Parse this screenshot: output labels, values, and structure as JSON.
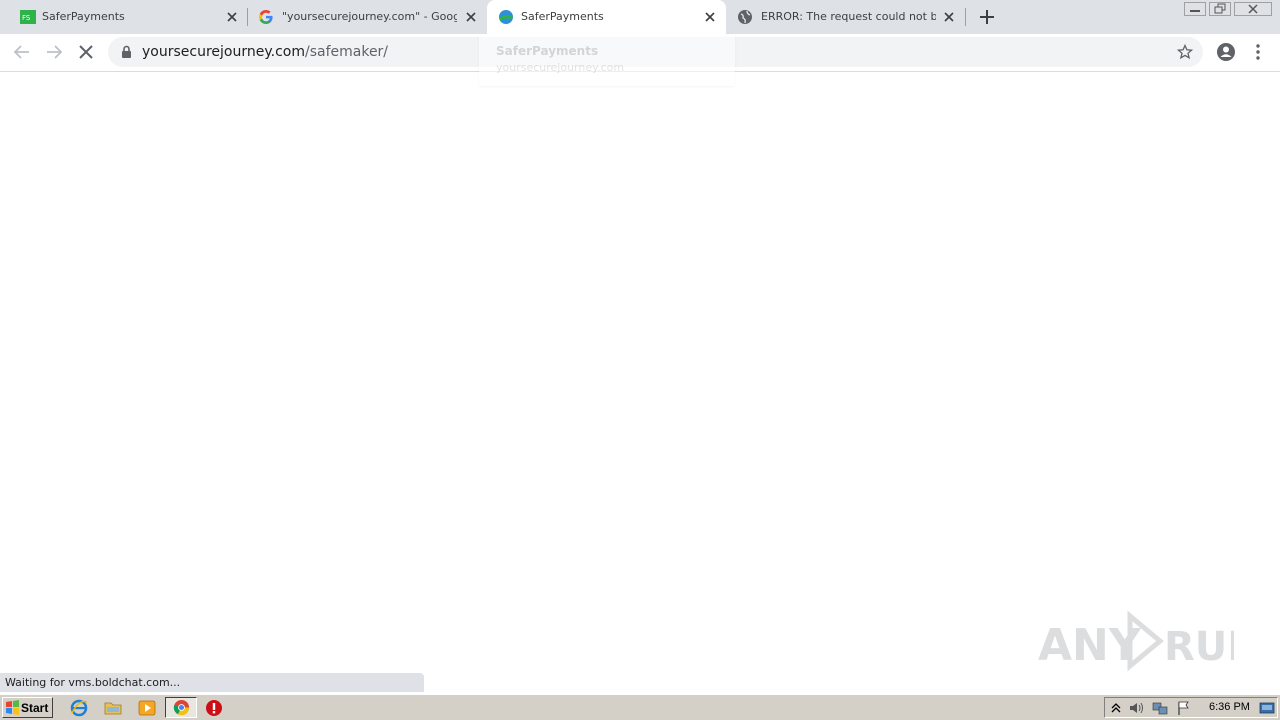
{
  "browser": {
    "tabs": [
      {
        "title": "SaferPayments",
        "favicon": "saferpayments-green-logo-icon",
        "active": false
      },
      {
        "title": "\"yoursecurejourney.com\" - Google S",
        "favicon": "google-g-icon",
        "active": false
      },
      {
        "title": "SaferPayments",
        "favicon": "saferpayments-globe-logo-icon",
        "active": true
      },
      {
        "title": "ERROR: The request could not be sa",
        "favicon": "globe-icon",
        "active": false
      }
    ],
    "address": {
      "host": "yoursecurejourney.com",
      "path": "/safemaker/"
    },
    "hover_card": {
      "title": "SaferPayments",
      "url": "yoursecurejourney.com"
    },
    "status_text": "Waiting for vms.boldchat.com..."
  },
  "watermark": {
    "text": "ANY RUN"
  },
  "taskbar": {
    "start_label": "Start",
    "clock": "6:36 PM"
  },
  "colors": {
    "tabstrip": "#dee1e6",
    "omnibox": "#f1f3f4",
    "taskbar": "#d4d0c8",
    "saferpayments_green": "#2db34a"
  }
}
